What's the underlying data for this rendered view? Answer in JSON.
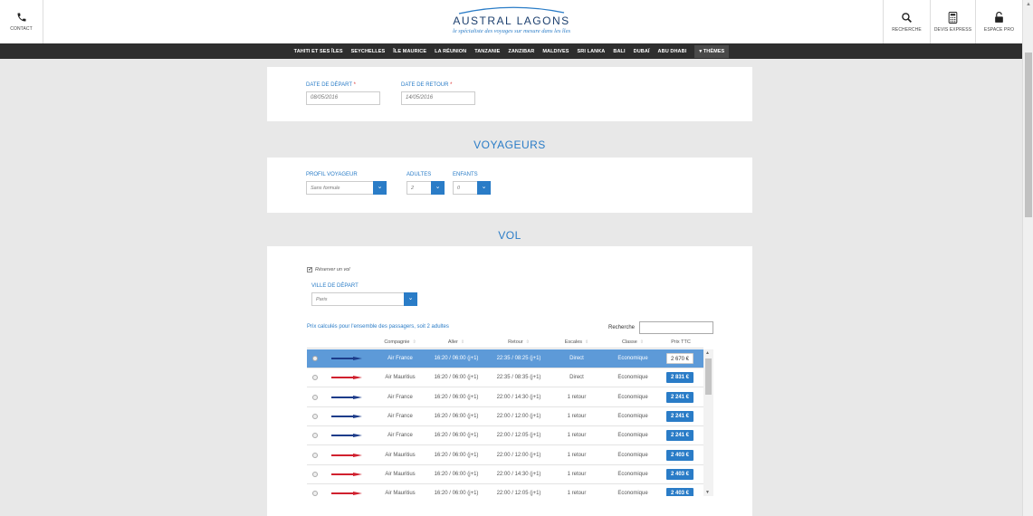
{
  "header": {
    "contact_label": "CONTACT",
    "search_label": "RECHERCHE",
    "quote_label": "DEVIS EXPRESS",
    "pro_label": "ESPACE PRO",
    "brand": "AUSTRAL LAGONS",
    "tagline": "le spécialiste des voyages sur mesure dans les îles"
  },
  "nav": {
    "items": [
      "TAHITI ET SES ÎLES",
      "SEYCHELLES",
      "ÎLE MAURICE",
      "LA RÉUNION",
      "TANZANIE",
      "ZANZIBAR",
      "MALDIVES",
      "SRI LANKA",
      "BALI",
      "DUBAÏ",
      "ABU DHABI"
    ],
    "themes": "THÈMES"
  },
  "dates": {
    "departure_label": "DATE DE DÉPART",
    "departure_value": "08/05/2016",
    "return_label": "DATE DE RETOUR",
    "return_value": "14/05/2016",
    "required_mark": "*"
  },
  "travelers": {
    "title": "VOYAGEURS",
    "profile_label": "PROFIL VOYAGEUR",
    "profile_value": "Sans formule",
    "adults_label": "ADULTES",
    "adults_value": "2",
    "children_label": "ENFANTS",
    "children_value": "0"
  },
  "flight": {
    "title": "VOL",
    "book_flight_label": "Réserver un vol",
    "book_flight_checked": true,
    "departure_city_label": "VILLE DE DÉPART",
    "departure_city_value": "Paris",
    "price_note": "Prix calculés pour l'ensemble des passagers, soit 2 adultes",
    "search_label": "Recherche",
    "columns": [
      "Compagnie",
      "Aller",
      "Retour",
      "Escales",
      "Classe",
      "Prix TTC"
    ],
    "rows": [
      {
        "airline": "Air France",
        "aller": "16:20 / 06:00 (j+1)",
        "retour": "22:35 / 08:25 (j+1)",
        "escales": "Direct",
        "classe": "Economique",
        "prix": "2 670 €",
        "selected": true
      },
      {
        "airline": "Air Mauritius",
        "aller": "16:20 / 06:00 (j+1)",
        "retour": "22:35 / 08:35 (j+1)",
        "escales": "Direct",
        "classe": "Economique",
        "prix": "2 831 €",
        "selected": false
      },
      {
        "airline": "Air France",
        "aller": "16:20 / 06:00 (j+1)",
        "retour": "22:00 / 14:30 (j+1)",
        "escales": "1 retour",
        "classe": "Economique",
        "prix": "2 241 €",
        "selected": false
      },
      {
        "airline": "Air France",
        "aller": "16:20 / 06:00 (j+1)",
        "retour": "22:00 / 12:00 (j+1)",
        "escales": "1 retour",
        "classe": "Economique",
        "prix": "2 241 €",
        "selected": false
      },
      {
        "airline": "Air France",
        "aller": "16:20 / 06:00 (j+1)",
        "retour": "22:00 / 12:05 (j+1)",
        "escales": "1 retour",
        "classe": "Economique",
        "prix": "2 241 €",
        "selected": false
      },
      {
        "airline": "Air Mauritius",
        "aller": "16:20 / 06:00 (j+1)",
        "retour": "22:00 / 12:00 (j+1)",
        "escales": "1 retour",
        "classe": "Economique",
        "prix": "2 403 €",
        "selected": false
      },
      {
        "airline": "Air Mauritius",
        "aller": "16:20 / 06:00 (j+1)",
        "retour": "22:00 / 14:30 (j+1)",
        "escales": "1 retour",
        "classe": "Economique",
        "prix": "2 403 €",
        "selected": false
      },
      {
        "airline": "Air Mauritius",
        "aller": "16:20 / 06:00 (j+1)",
        "retour": "22:00 / 12:05 (j+1)",
        "escales": "1 retour",
        "classe": "Economique",
        "prix": "2 403 €",
        "selected": false
      }
    ]
  },
  "colors": {
    "accent": "#2a7cc7",
    "nav_bg": "#2e2e2e",
    "selected_row": "#5d9ad8",
    "air_france_logo": "#1d3c8a",
    "air_mauritius_logo": "#d0202e"
  }
}
